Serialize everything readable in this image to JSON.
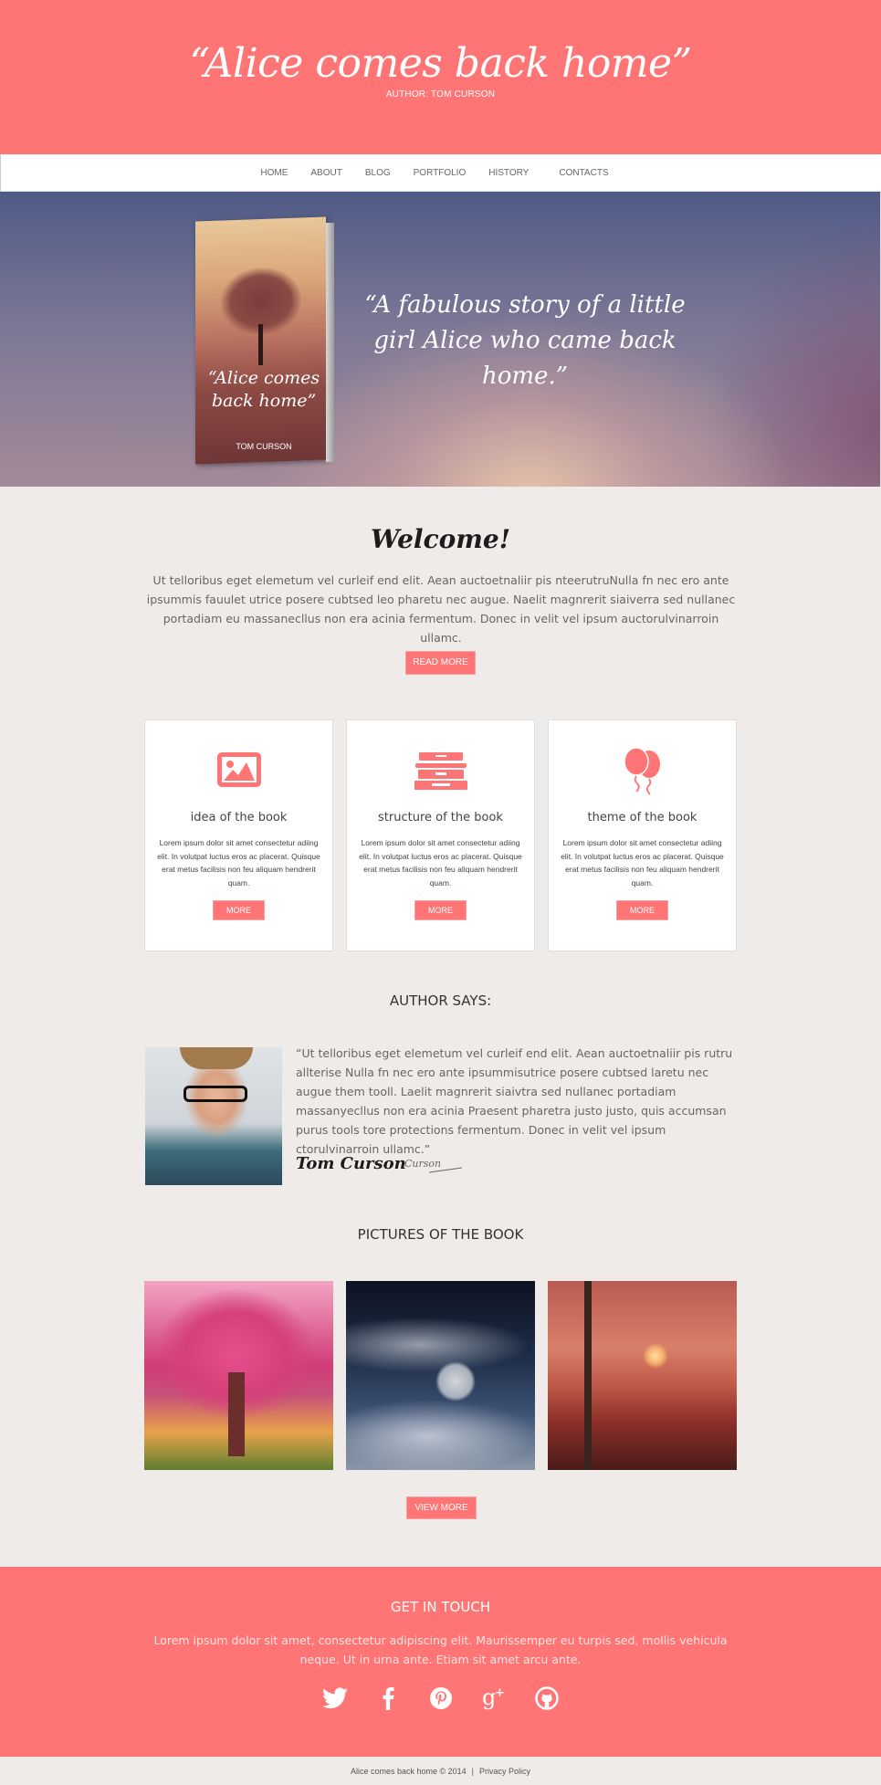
{
  "header": {
    "title": "“Alice comes back home”",
    "author": "AUTHOR: TOM CURSON"
  },
  "nav": {
    "items": [
      "HOME",
      "ABOUT",
      "BLOG",
      "PORTFOLIO",
      "HISTORY",
      "CONTACTS"
    ]
  },
  "hero": {
    "book_cover_title": "“Alice comes back home”",
    "book_cover_author": "TOM CURSON",
    "quote": "“A fabulous story of a little girl Alice who came back home.”"
  },
  "welcome": {
    "title": "Welcome!",
    "text": "Ut telloribus eget elemetum vel curleif end elit. Aean auctoetnaliir pis nteerutruNulla fn nec ero ante ipsummis fauulet utrice posere cubtsed leo pharetu nec augue. Naelit magnrerit siaiverra sed nullanec portadiam eu massanecllus non era acinia fermentum. Donec in velit vel ipsum auctorulvinarroin ullamc.",
    "button": "READ MORE"
  },
  "cards": [
    {
      "icon": "image-icon",
      "title": "idea of the book",
      "text": "Lorem ipsum dolor sit amet consectetur adiing elit. In volutpat luctus eros ac placerat. Quisque erat metus facilisis non feu aliquam hendrerit quam.",
      "button": "MORE"
    },
    {
      "icon": "books-icon",
      "title": "structure of the book",
      "text": "Lorem ipsum dolor sit amet consectetur adiing elit. In volutpat luctus eros ac placerat. Quisque erat metus facilisis non feu aliquam hendrerit quam.",
      "button": "MORE"
    },
    {
      "icon": "balloons-icon",
      "title": "theme of the book",
      "text": "Lorem ipsum dolor sit amet consectetur adiing elit. In volutpat luctus eros ac placerat. Quisque erat metus facilisis non feu aliquam hendrerit quam.",
      "button": "MORE"
    }
  ],
  "author_section": {
    "heading": "AUTHOR SAYS:",
    "quote": "“Ut telloribus eget elemetum vel curleif end elit. Aean auctoetnaliir pis rutru allterise Nulla fn nec ero ante ipsummisutrice posere cubtsed laretu nec augue them tooll. Laelit magnrerit siaivtra sed nullanec portadiam massanyecllus non era acinia Praesent pharetra justo justo, quis accumsan purus tools tore protections fermentum. Donec in velit vel ipsum ctorulvinarroin ullamc.”",
    "name": "Tom Curson",
    "signature": "Curson"
  },
  "pictures": {
    "heading": "PICTURES OF THE BOOK",
    "items": [
      "pink-blossom-tree",
      "moon-in-clouds",
      "sunset-pier"
    ],
    "button": "VIEW MORE"
  },
  "footer": {
    "heading": "GET IN  TOUCH",
    "text": "Lorem ipsum dolor sit amet, consectetur adipiscing elit. Maurissemper eu turpis sed, mollis vehicula neque. Ut in urna ante. Etiam sit amet arcu ante.",
    "social": [
      "twitter-icon",
      "facebook-icon",
      "pinterest-icon",
      "google-plus-icon",
      "github-icon"
    ],
    "copyright": "Alice comes back home © 2014",
    "separator": "|",
    "privacy_link": "Privacy Policy"
  },
  "colors": {
    "accent": "#ff7474",
    "background": "#efebe8",
    "text": "#666666"
  }
}
